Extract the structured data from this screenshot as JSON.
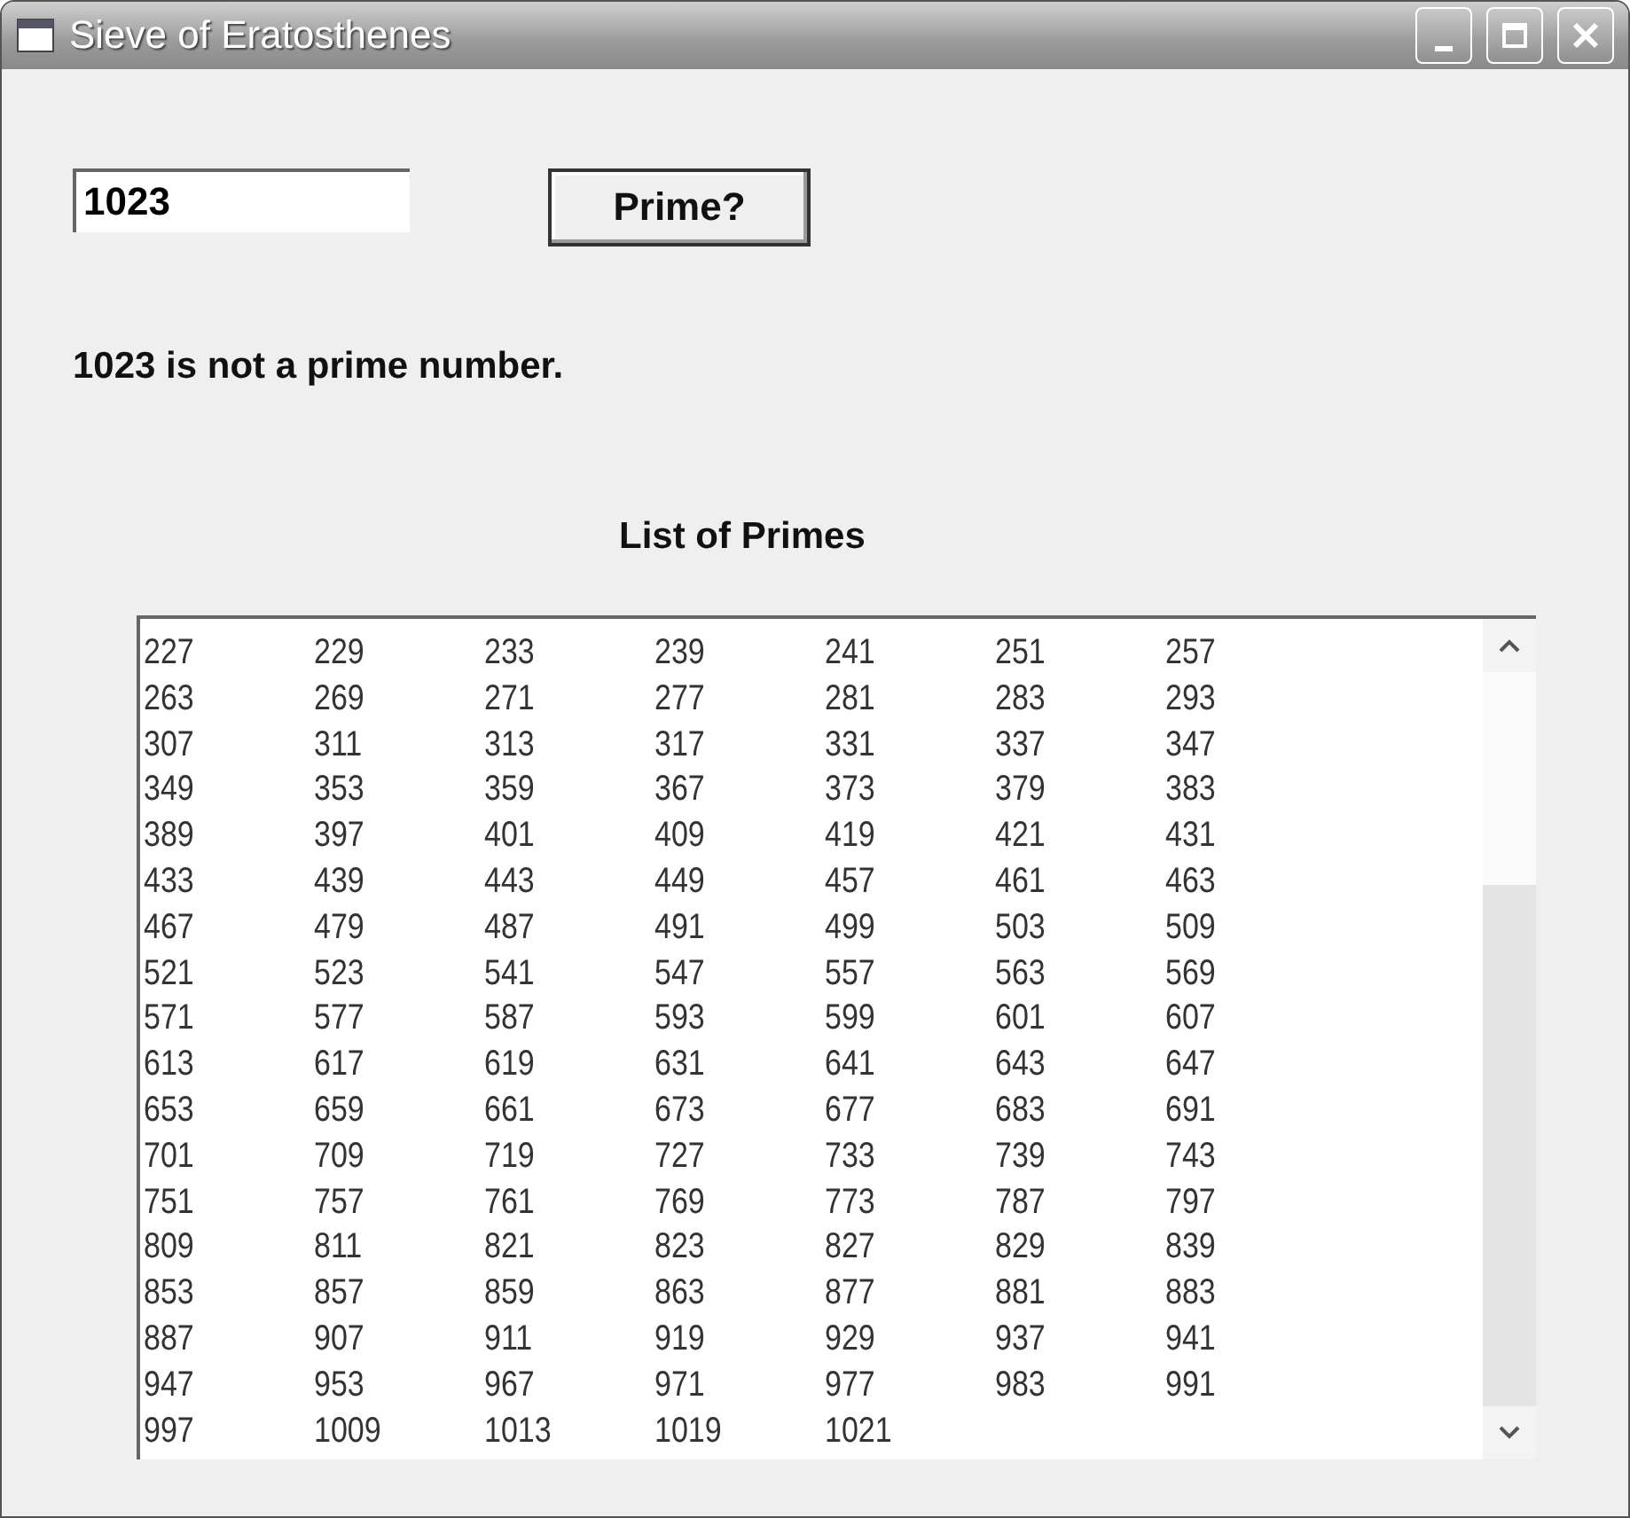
{
  "window": {
    "title": "Sieve of Eratosthenes"
  },
  "number_field": {
    "value": "1023"
  },
  "check_button": {
    "label": "Prime?"
  },
  "result_message": "1023 is not a prime number.",
  "list_title": "List of Primes",
  "primes_list": {
    "rows": [
      [
        "227",
        "229",
        "233",
        "239",
        "241",
        "251",
        "257"
      ],
      [
        "263",
        "269",
        "271",
        "277",
        "281",
        "283",
        "293"
      ],
      [
        "307",
        "311",
        "313",
        "317",
        "331",
        "337",
        "347"
      ],
      [
        "349",
        "353",
        "359",
        "367",
        "373",
        "379",
        "383"
      ],
      [
        "389",
        "397",
        "401",
        "409",
        "419",
        "421",
        "431"
      ],
      [
        "433",
        "439",
        "443",
        "449",
        "457",
        "461",
        "463"
      ],
      [
        "467",
        "479",
        "487",
        "491",
        "499",
        "503",
        "509"
      ],
      [
        "521",
        "523",
        "541",
        "547",
        "557",
        "563",
        "569"
      ],
      [
        "571",
        "577",
        "587",
        "593",
        "599",
        "601",
        "607"
      ],
      [
        "613",
        "617",
        "619",
        "631",
        "641",
        "643",
        "647"
      ],
      [
        "653",
        "659",
        "661",
        "673",
        "677",
        "683",
        "691"
      ],
      [
        "701",
        "709",
        "719",
        "727",
        "733",
        "739",
        "743"
      ],
      [
        "751",
        "757",
        "761",
        "769",
        "773",
        "787",
        "797"
      ],
      [
        "809",
        "811",
        "821",
        "823",
        "827",
        "829",
        "839"
      ],
      [
        "853",
        "857",
        "859",
        "863",
        "877",
        "881",
        "883"
      ],
      [
        "887",
        "907",
        "911",
        "919",
        "929",
        "937",
        "941"
      ],
      [
        "947",
        "953",
        "967",
        "971",
        "977",
        "983",
        "991"
      ],
      [
        "997",
        "1009",
        "1013",
        "1019",
        "1021"
      ]
    ]
  }
}
